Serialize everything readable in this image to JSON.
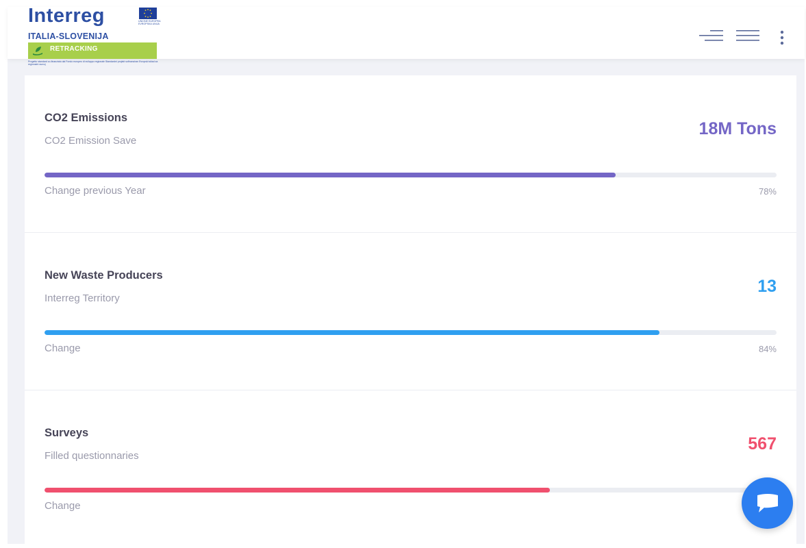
{
  "header": {
    "logo_word": "Interreg",
    "logo_sub": "ITALIA-SLOVENIJA",
    "eu_text": "UNIONE EUROPEA EVROPSKA UNIJA",
    "retracking_label": "RETRACKING",
    "fine_print": "Progetto standard co-finanziato dal Fondo europeo di sviluppo regionale Standardni projekt sofinanciran Evropski sklad za regionalni razvoj",
    "icons": [
      "menu-right-align-icon",
      "hamburger-menu-icon",
      "kebab-menu-icon"
    ]
  },
  "stats": [
    {
      "title": "CO2 Emissions",
      "description": "CO2 Emission Save",
      "value": "18M Tons",
      "color": "#7466c6",
      "change_label": "Change previous Year",
      "change_pct": "78%",
      "progress": 0.78
    },
    {
      "title": "New Waste Producers",
      "description": "Interreg Territory",
      "value": "13",
      "color": "#2f9ff0",
      "change_label": "Change",
      "change_pct": "84%",
      "progress": 0.84
    },
    {
      "title": "Surveys",
      "description": "Filled questionnaries",
      "value": "567",
      "color": "#f0506e",
      "change_label": "Change",
      "change_pct": "",
      "progress": 0.69
    }
  ],
  "chat": {
    "icon": "chat-bubble-icon",
    "color": "#2c7ef0"
  }
}
